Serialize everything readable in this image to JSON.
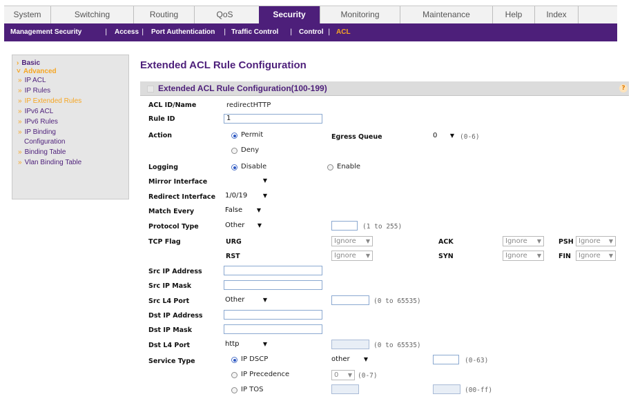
{
  "tabs": [
    "System",
    "Switching",
    "Routing",
    "QoS",
    "Security",
    "Monitoring",
    "Maintenance",
    "Help",
    "Index"
  ],
  "active_tab": "Security",
  "subnav": [
    "Management Security",
    "Access",
    "Port Authentication",
    "Traffic Control",
    "Control",
    "ACL"
  ],
  "subnav_sep": "|",
  "active_subnav": "ACL",
  "nav": {
    "basic": "Basic",
    "advanced": "Advanced",
    "items": [
      "IP ACL",
      "IP Rules",
      "IP Extended Rules",
      "IPv6 ACL",
      "IPv6 Rules",
      "IP Binding",
      "Configuration",
      "Binding Table",
      "Vlan Binding Table"
    ],
    "marker_collapsed": "›",
    "marker_open": "˅",
    "marker_item": "»"
  },
  "page_title": "Extended ACL Rule Configuration",
  "panel_title": "Extended ACL Rule Configuration(100-199)",
  "help_icon": "?",
  "form": {
    "acl_id_label": "ACL ID/Name",
    "acl_id_value": "redirectHTTP",
    "rule_id_label": "Rule ID",
    "rule_id_value": "1",
    "action_label": "Action",
    "permit": "Permit",
    "deny": "Deny",
    "egress_queue_label": "Egress Queue",
    "egress_queue_value": "0",
    "egress_queue_hint": "(0-6)",
    "logging_label": "Logging",
    "disable": "Disable",
    "enable": "Enable",
    "mirror_interface_label": "Mirror Interface",
    "mirror_interface_value": "",
    "redirect_interface_label": "Redirect Interface",
    "redirect_interface_value": "1/0/19",
    "match_every_label": "Match Every",
    "match_every_value": "False",
    "protocol_type_label": "Protocol Type",
    "protocol_type_value": "Other",
    "protocol_hint": "(1 to 255)",
    "tcp_flag_label": "TCP Flag",
    "urg": "URG",
    "ack": "ACK",
    "psh": "PSH",
    "rst": "RST",
    "syn": "SYN",
    "fin": "FIN",
    "ignore": "Ignore",
    "src_ip_label": "Src IP Address",
    "src_mask_label": "Src IP Mask",
    "src_l4_label": "Src L4 Port",
    "src_l4_value": "Other",
    "port_hint": "(0 to 65535)",
    "dst_ip_label": "Dst IP Address",
    "dst_mask_label": "Dst IP Mask",
    "dst_l4_label": "Dst L4 Port",
    "dst_l4_value": "http",
    "service_type_label": "Service Type",
    "ip_dscp": "IP DSCP",
    "ip_dscp_value": "other",
    "dscp_hint": "(0-63)",
    "ip_precedence": "IP Precedence",
    "precedence_value": "0",
    "precedence_hint": "(0-7)",
    "ip_tos": "IP TOS",
    "tos_hint": "(00-ff)",
    "arrow": "▼"
  }
}
